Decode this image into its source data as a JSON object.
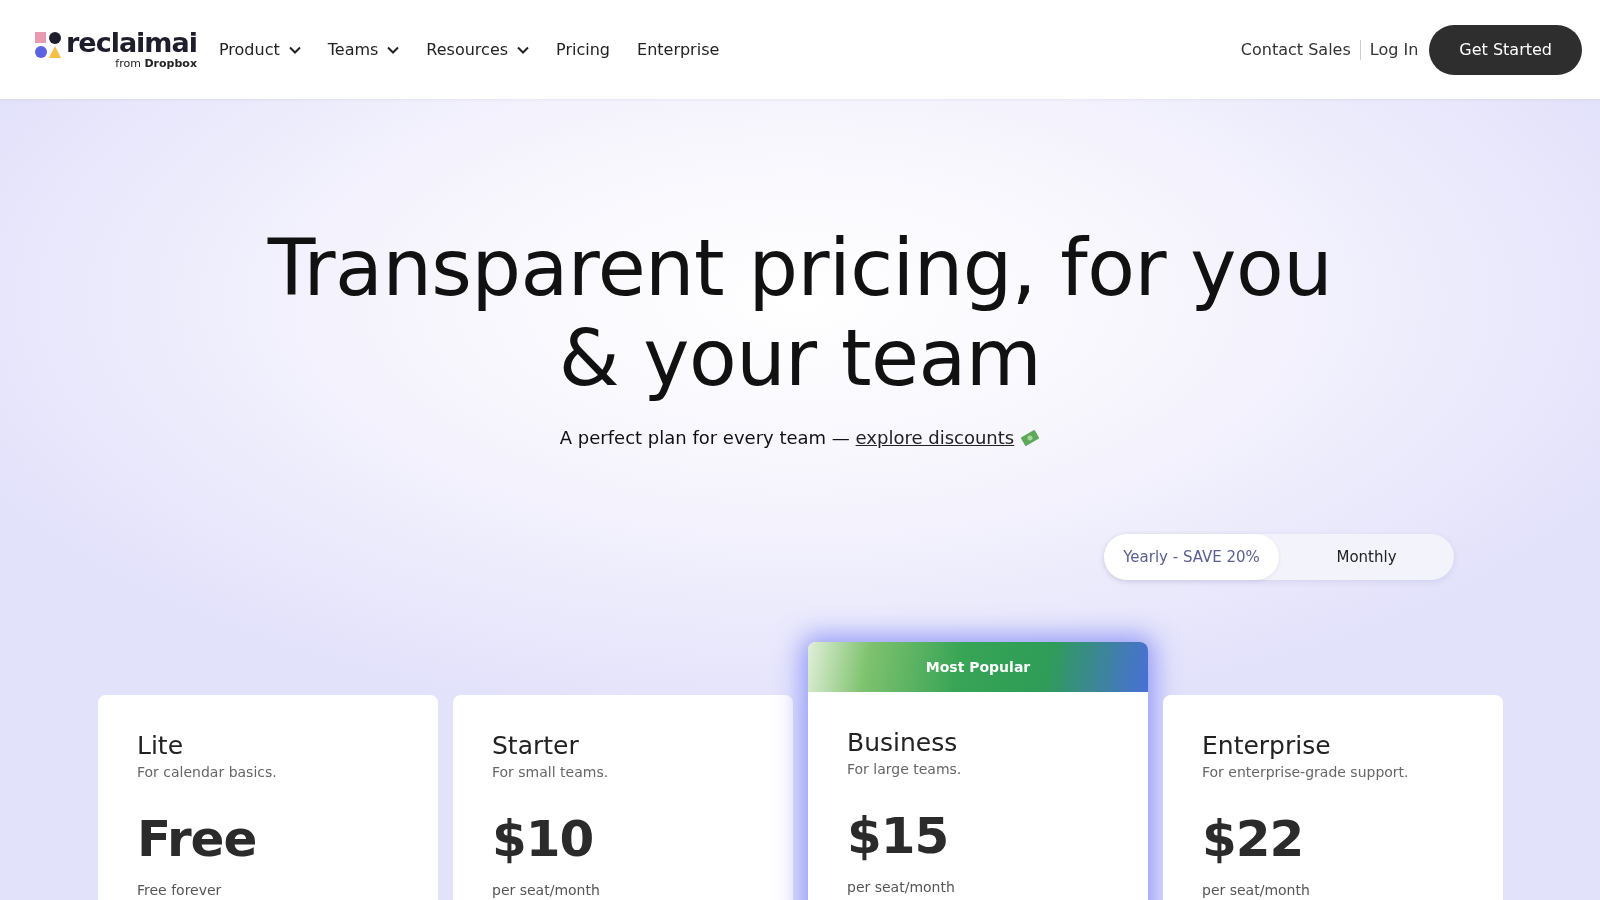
{
  "brand": {
    "name": "reclaimai",
    "from": "from",
    "company": "Dropbox"
  },
  "nav": [
    {
      "label": "Product",
      "dropdown": true
    },
    {
      "label": "Teams",
      "dropdown": true
    },
    {
      "label": "Resources",
      "dropdown": true
    },
    {
      "label": "Pricing",
      "dropdown": false
    },
    {
      "label": "Enterprise",
      "dropdown": false
    }
  ],
  "header_actions": {
    "contact": "Contact Sales",
    "login": "Log In",
    "cta": "Get Started"
  },
  "hero": {
    "title": "Transparent pricing, for you & your team",
    "subtitle": "A perfect plan for every team — ",
    "link": "explore discounts"
  },
  "billing_toggle": [
    {
      "label": "Yearly - SAVE 20%",
      "selected": true
    },
    {
      "label": "Monthly",
      "selected": false
    }
  ],
  "plans": [
    {
      "name": "Lite",
      "description": "For calendar basics.",
      "price": "Free",
      "period": "Free forever",
      "featured": false
    },
    {
      "name": "Starter",
      "description": "For small teams.",
      "price": "$10",
      "period": "per seat/month",
      "featured": false
    },
    {
      "name": "Business",
      "description": "For large teams.",
      "price": "$15",
      "period": "per seat/month",
      "featured": true,
      "badge": "Most Popular"
    },
    {
      "name": "Enterprise",
      "description": "For enterprise-grade support.",
      "price": "$22",
      "period": "per seat/month",
      "featured": false
    }
  ]
}
